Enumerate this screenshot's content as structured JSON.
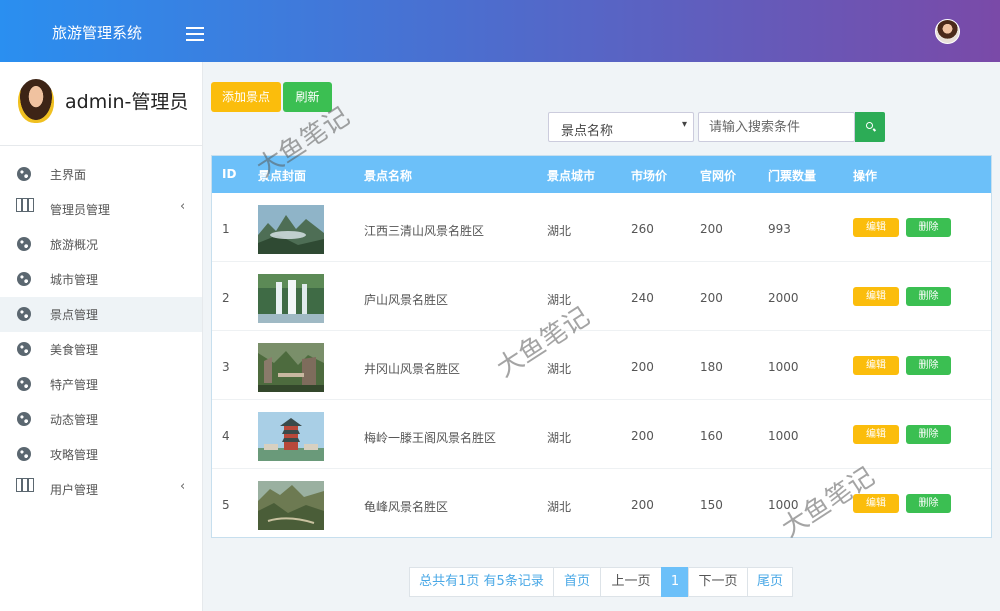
{
  "header": {
    "app_title": "旅游管理系统",
    "menu_icon": "hamburger-icon",
    "avatar_icon": "user-avatar"
  },
  "sidebar": {
    "profile_name": "admin-管理员",
    "items": [
      {
        "label": "主界面",
        "icon": "globe-icon"
      },
      {
        "label": "管理员管理",
        "icon": "map-icon",
        "caret": "‹"
      },
      {
        "label": "旅游概况",
        "icon": "globe-icon"
      },
      {
        "label": "城市管理",
        "icon": "globe-icon"
      },
      {
        "label": "景点管理",
        "icon": "globe-icon"
      },
      {
        "label": "美食管理",
        "icon": "globe-icon"
      },
      {
        "label": "特产管理",
        "icon": "globe-icon"
      },
      {
        "label": "动态管理",
        "icon": "globe-icon"
      },
      {
        "label": "攻略管理",
        "icon": "globe-icon"
      },
      {
        "label": "用户管理",
        "icon": "map-icon",
        "caret": "‹"
      }
    ],
    "active_item": "景点管理"
  },
  "toolbar": {
    "add_label": "添加景点",
    "refresh_label": "刷新"
  },
  "search": {
    "select_value": "景点名称",
    "placeholder": "请输入搜索条件",
    "button_icon": "search-icon"
  },
  "table": {
    "headers": [
      "ID",
      "景点封面",
      "景点名称",
      "景点城市",
      "市场价",
      "官网价",
      "门票数量",
      "操作"
    ],
    "rows": [
      {
        "id": "1",
        "name": "江西三清山风景名胜区",
        "city": "湖北",
        "market_price": "260",
        "official_price": "200",
        "tickets": "993"
      },
      {
        "id": "2",
        "name": "庐山风景名胜区",
        "city": "湖北",
        "market_price": "240",
        "official_price": "200",
        "tickets": "2000"
      },
      {
        "id": "3",
        "name": "井冈山风景名胜区",
        "city": "湖北",
        "market_price": "200",
        "official_price": "180",
        "tickets": "1000"
      },
      {
        "id": "4",
        "name": "梅岭一滕王阁风景名胜区",
        "city": "湖北",
        "market_price": "200",
        "official_price": "160",
        "tickets": "1000"
      },
      {
        "id": "5",
        "name": "龟峰风景名胜区",
        "city": "湖北",
        "market_price": "200",
        "official_price": "150",
        "tickets": "1000"
      }
    ],
    "edit_label": "编辑",
    "delete_label": "删除"
  },
  "pagination": {
    "summary": "总共有1页 有5条记录",
    "first": "首页",
    "prev": "上一页",
    "current": "1",
    "next": "下一页",
    "last": "尾页"
  },
  "watermark": "大鱼笔记",
  "colors": {
    "accent_blue": "#6cc0f9",
    "warning": "#fbbd0c",
    "success": "#3bbf52"
  }
}
